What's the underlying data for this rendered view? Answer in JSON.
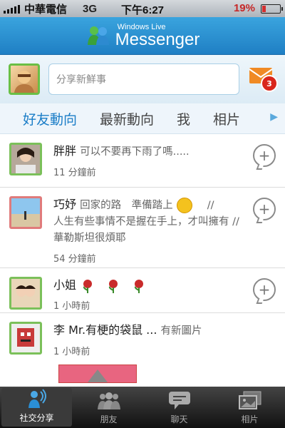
{
  "status": {
    "carrier": "中華電信",
    "network": "3G",
    "time": "下午6:27",
    "battery_pct": "19%"
  },
  "header": {
    "brand_small": "Windows Live",
    "brand_big": "Messenger"
  },
  "compose": {
    "placeholder": "分享新鮮事",
    "mail_badge": "3"
  },
  "tabs": [
    {
      "label": "好友動向"
    },
    {
      "label": "最新動向"
    },
    {
      "label": "我"
    },
    {
      "label": "相片"
    }
  ],
  "feed": [
    {
      "name": "胖胖",
      "message": "可以不要再下雨了嗎.....",
      "time": "11 分鐘前"
    },
    {
      "name": "巧妤",
      "message_1": "回家的路　準備踏上",
      "message_2": "//",
      "message_3": "人生有些事情不是握在手上，才叫擁有 // 華勒斯坦很煩耶",
      "time": "54 分鐘前"
    },
    {
      "name": "小姐",
      "time": "1 小時前"
    },
    {
      "name": "李 Mr.有梗的袋鼠 ...",
      "message": "有新圖片",
      "time": "1 小時前"
    }
  ],
  "tabbar": [
    {
      "label": "社交分享"
    },
    {
      "label": "朋友"
    },
    {
      "label": "聊天"
    },
    {
      "label": "相片"
    }
  ],
  "colors": {
    "accent": "#1a7dc7",
    "header": "#2b90d2",
    "avatar_border": "#7bc05a"
  }
}
